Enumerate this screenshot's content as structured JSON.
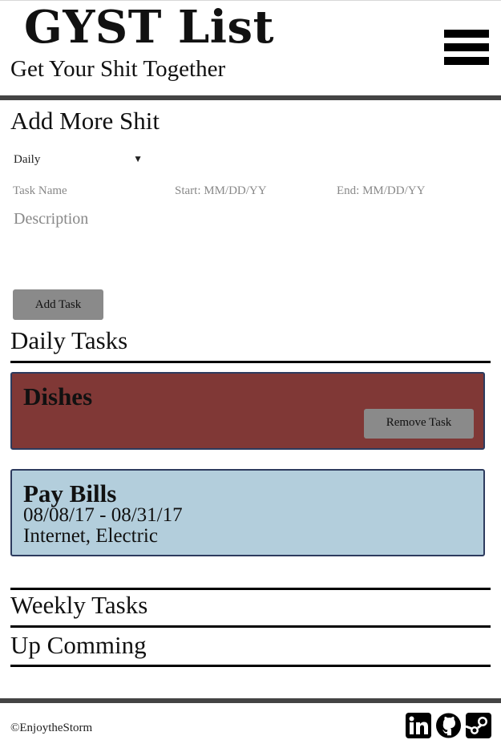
{
  "header": {
    "title": "GYST List",
    "subtitle": "Get Your Shit Together"
  },
  "add_form": {
    "heading": "Add More Shit",
    "frequency_selected": "Daily",
    "task_name_placeholder": "Task Name",
    "start_placeholder": "Start: MM/DD/YY",
    "end_placeholder": "End: MM/DD/YY",
    "description_placeholder": "Description",
    "add_button_label": "Add Task"
  },
  "daily": {
    "heading": "Daily Tasks",
    "tasks": [
      {
        "title": "Dishes",
        "remove_label": "Remove Task",
        "color": "#803836"
      },
      {
        "title": "Pay Bills",
        "dates": "08/08/17 - 08/31/17",
        "description": "Internet, Electric",
        "color": "#b3cedc"
      }
    ]
  },
  "weekly": {
    "heading": "Weekly Tasks"
  },
  "upcoming": {
    "heading": "Up Comming"
  },
  "footer": {
    "copyright": "©EnjoytheStorm",
    "social": [
      "linkedin-icon",
      "github-icon",
      "steam-icon"
    ]
  }
}
